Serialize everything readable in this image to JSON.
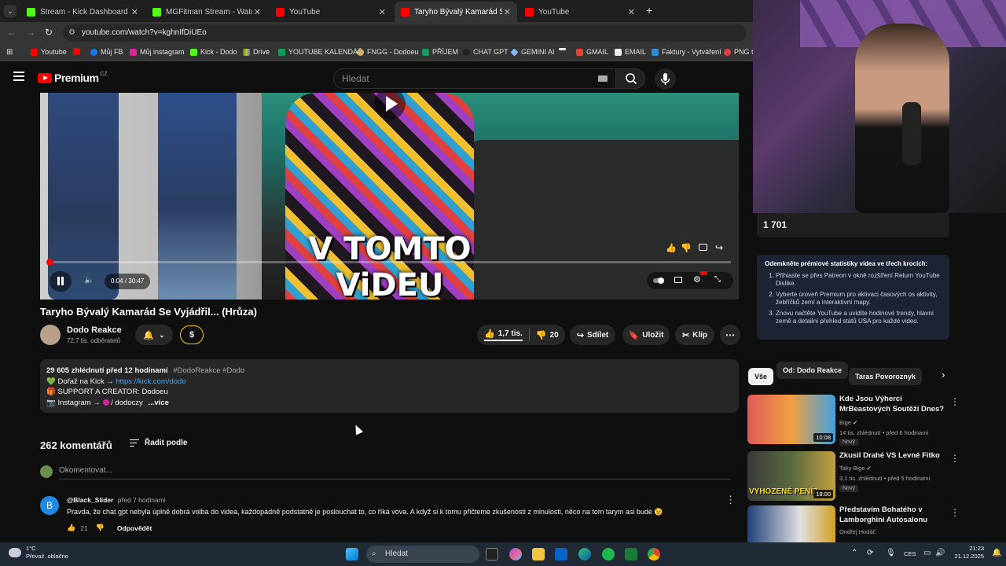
{
  "browser": {
    "tabs": [
      {
        "label": "Stream - Kick Dashboard",
        "color": "#53fc18"
      },
      {
        "label": "MGFitman Stream - Watch Live",
        "color": "#53fc18"
      },
      {
        "label": "YouTube",
        "color": "#ff0000"
      },
      {
        "label": "Taryho Bývalý Kamarád Se Vyjádř",
        "color": "#ff0000"
      },
      {
        "label": "YouTube",
        "color": "#ff0000"
      }
    ],
    "url": "youtube.com/watch?v=kghnIfDiUEo",
    "bookmarks": [
      "Youtube",
      "Můj FB",
      "Můj instagram",
      "Kick - Dodo",
      "Drive",
      "YOUTUBE KALENDÁŘ",
      "FNGG - Dodoeu",
      "PŘÍJEM",
      "CHAT GPT",
      "GEMINI AI",
      "GMAIL",
      "EMAIL",
      "Faktury - Vytváření",
      "PNG t"
    ]
  },
  "youtube": {
    "logo_text": "Premium",
    "logo_region": "CZ",
    "search_placeholder": "Hledat",
    "video": {
      "overlay_text": "V TOMTO ViDEU",
      "time": "0:04 / 30:47",
      "progress": 0.002
    },
    "title": "Taryho Bývalý Kamarád Se Vyjádřil... (Hrůza)",
    "channel": {
      "name": "Dodo Reakce",
      "subscribers": "72,7 tis. odběratelů"
    },
    "actions": {
      "likes": "1,7 tis.",
      "dislikes": "20",
      "share": "Sdílet",
      "save": "Uložit",
      "clip": "Klip",
      "support": "$"
    },
    "description": {
      "views_date": "29 605 zhlédnutí  před 12 hodinami",
      "tags": "#DodoReakce #Dodo",
      "line1_prefix": "💚 Dořaž na Kick → ",
      "line1_link": "https://kick.com/dodo",
      "line2": "🎁 SUPPORT A CREATOR: Dodoeu",
      "line3_prefix": "📷 Instagram → ",
      "line3_handle": " / dodoczy",
      "more": "...více"
    },
    "comments": {
      "count": "262 komentářů",
      "sort": "Řadit podle",
      "add_placeholder": "Okomentovat...",
      "items": [
        {
          "avatar_letter": "B",
          "user": "@Black_Slider",
          "time": "před 7 hodinami",
          "text": "Pravda, že chat gpt nebyla úplně dobrá volba do videa, každopádně podstatně je poslouchat to, co říká vova. A když si k tomu přičteme zkušenosti z minulosti, něco na tom tarym asi bude 😉",
          "likes": "21",
          "reply": "Odpovědět"
        }
      ]
    },
    "sidebar": {
      "stat_value": "1 701",
      "promo_title": "Odemkněte prémiové statistiky videa ve třech krocích:",
      "promo_steps": [
        "Přihlaste se přes Patreon v okně rozšíření Return YouTube Dislike.",
        "Vyberte úroveň Premium pro aktivaci časových os aktivity, žebříčků zemí a interaktivní mapy.",
        "Znovu načtěte YouTube a uvidíte hodinové trendy, hlavní země a detailní přehled států USA pro každé video."
      ],
      "chips": [
        "Vše",
        "Od: Dodo Reakce",
        "Taras Povoroznyk"
      ],
      "recommendations": [
        {
          "title": "Kde Jsou Výherci MrBeastových Soutěží Dnes?",
          "channel": "Bige",
          "stats": "14 tis. zhlédnutí • před 6 hodinami",
          "badge": "Nový",
          "duration": "10:08"
        },
        {
          "title": "Zkusil Drahé VS Levné Fitko",
          "channel": "Taky Bige",
          "stats": "3,1 tis. zhlédnutí • před 5 hodinami",
          "badge": "Nový",
          "duration": "18:00",
          "thumb_text": "VYHOZENÉ PENÍZ"
        },
        {
          "title": "Představím Bohatého v Lamborghini Autosalonu",
          "channel": "Ondřej Hodáč",
          "stats": "",
          "badge": "",
          "duration": ""
        }
      ]
    }
  },
  "taskbar": {
    "weather_temp": "1°C",
    "weather_desc": "Převaž. oblačno",
    "search": "Hledat",
    "lang": "CES",
    "time": "21:23",
    "date": "21.12.2025"
  },
  "colors": {
    "accent_red": "#ff0000",
    "link": "#3ea6ff",
    "kick_green": "#53fc18"
  }
}
